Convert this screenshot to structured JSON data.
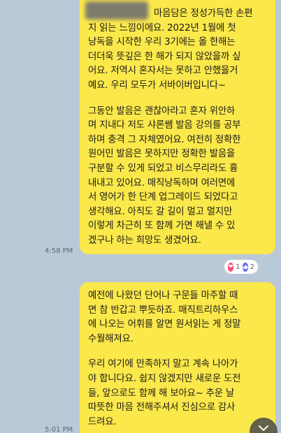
{
  "messages": [
    {
      "paragraphs": [
        "마음담은 정성가득한 손편\n지 읽는 느낌이에요. 2022년 1월에 첫\n낭독을 시작한 우리 3기에는 올 한해는\n더더욱 뜻깊은 한 해가 되지 않았을까 싶\n어요. 저역시 혼자서는 못하고 안했을거\n예요. 우리 모두가 서바이버입니다~",
        "그동안 발음은 괜찮아라고 혼자 위안하\n며 지내다 저도 샤론쌤 발음 강의를 공부\n하며 충격 그 자체였어요. 여전히 정확한\n원어민 발음은 못하지만 정확한 발음을\n구분할 수 있게 되었고 비스무리라도 흉\n내내고 있어요. 매직낭독하며 여러면에\n서 영어가 한 단계 업그레이드 되었다고\n생각해요. 아직도 갈 길이 멀고 멀지만\n이렇게 차근히 또 함께 가면 해낼 수 있\n겠구나 하는 희망도 생겼어요."
      ],
      "time": "4:58 PM",
      "reactions": {
        "heart_count": "1",
        "thumbs_count": "2"
      }
    },
    {
      "paragraphs": [
        "예전에 나왔던 단어나 구문들 마주할 때\n면 참 반갑고 뿌듯하죠. 매직트리하우스\n에 나오는 어휘를 알면 원서읽는 게 정말\n수월해져요.",
        "우리 여기에 만족하지 말고 계속 나아가\n야 합니다요. 쉽지 않겠지만 새로운 도전\n들, 앞으로도 함께 해 보아요~ 추운 날\n따뜻한 마음 전해주셔서 진심으로 감사\n드려요."
      ],
      "time": "5:01 PM"
    }
  ],
  "colors": {
    "background": "#bac9d8",
    "bubble": "#fbe84a",
    "heart": "#ff4a6e",
    "thumbs": "#5a5ee8"
  },
  "icons": {
    "heart": "heart-icon",
    "thumbs": "thumbs-up-icon",
    "scroll": "chevron-down-icon"
  }
}
